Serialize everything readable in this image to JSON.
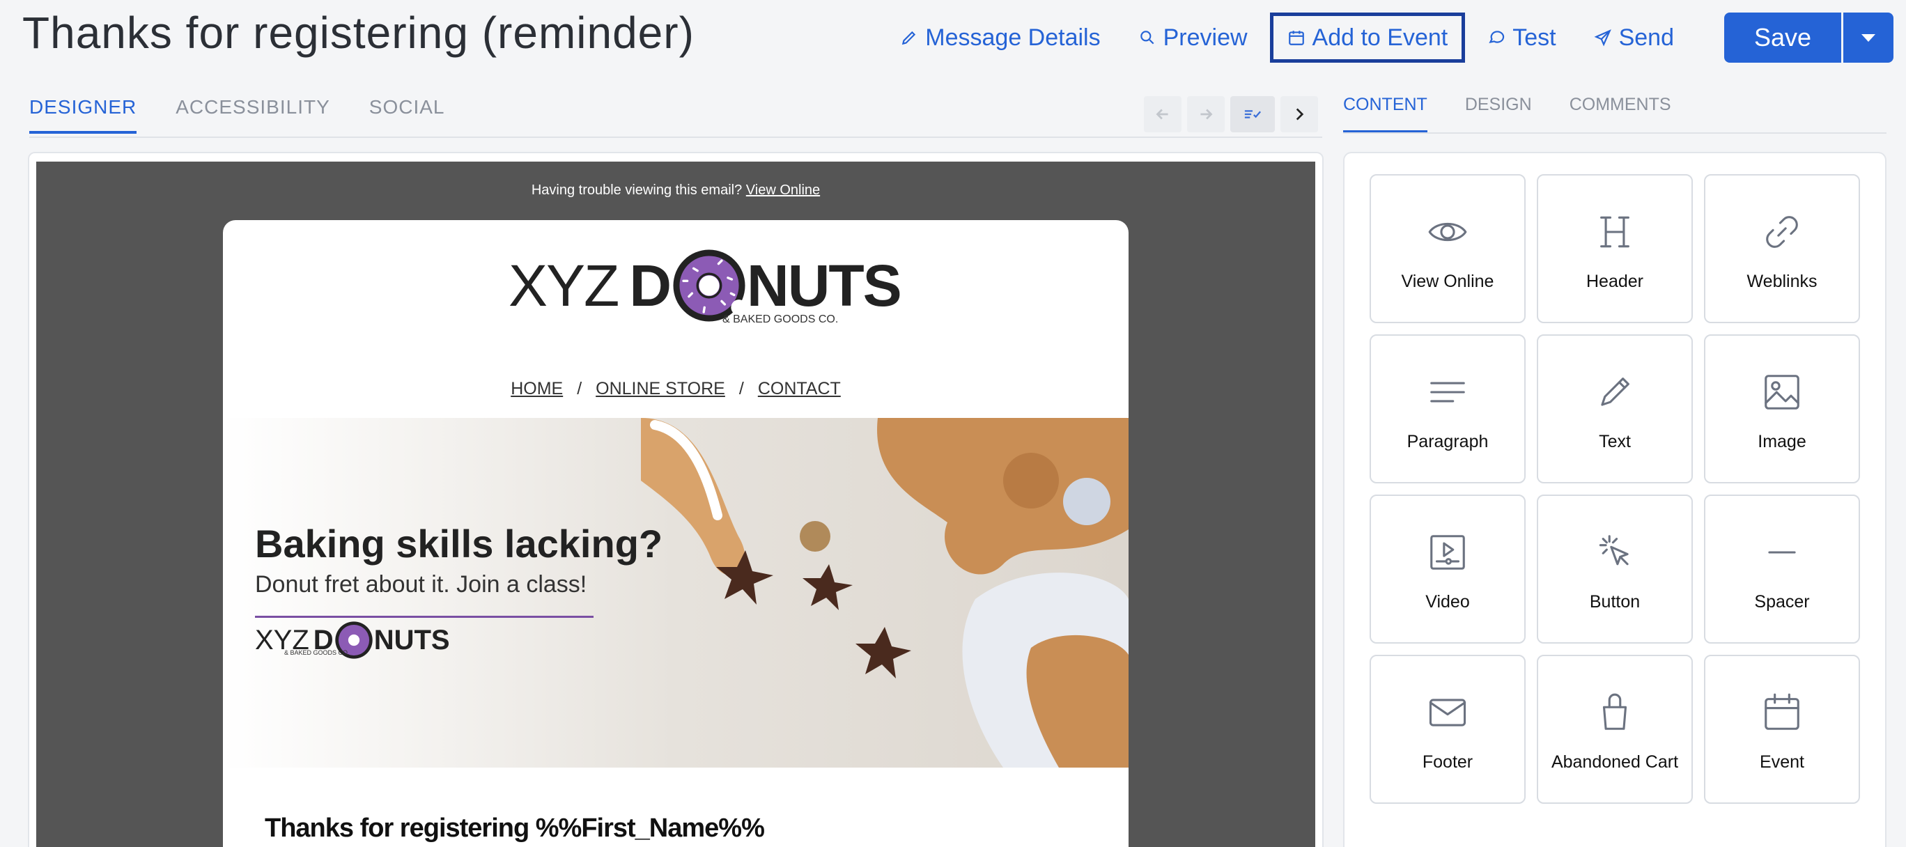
{
  "header": {
    "title": "Thanks for registering (reminder)",
    "actions": [
      {
        "label": "Message Details",
        "icon": "pencil-icon"
      },
      {
        "label": "Preview",
        "icon": "search-icon"
      },
      {
        "label": "Add to Event",
        "icon": "calendar-icon"
      },
      {
        "label": "Test",
        "icon": "comment-icon"
      },
      {
        "label": "Send",
        "icon": "send-icon"
      }
    ],
    "save_label": "Save"
  },
  "left_tabs": [
    "DESIGNER",
    "ACCESSIBILITY",
    "SOCIAL"
  ],
  "right_tabs": [
    "CONTENT",
    "DESIGN",
    "COMMENTS"
  ],
  "email": {
    "trouble_text": "Having trouble viewing this email?",
    "view_online": "View Online",
    "logo": {
      "xyz": "XYZ",
      "d": "D",
      "nuts": "NUTS",
      "sub": "& BAKED GOODS CO."
    },
    "nav": [
      "HOME",
      "ONLINE STORE",
      "CONTACT"
    ],
    "nav_sep": "/",
    "hero_title": "Baking skills lacking?",
    "hero_sub": "Donut fret about it. Join a class!",
    "thanks": "Thanks for registering %%First_Name%%"
  },
  "blocks": [
    {
      "label": "View Online",
      "icon": "eye-icon"
    },
    {
      "label": "Header",
      "icon": "heading-icon"
    },
    {
      "label": "Weblinks",
      "icon": "link-icon"
    },
    {
      "label": "Paragraph",
      "icon": "paragraph-icon"
    },
    {
      "label": "Text",
      "icon": "pencil-icon"
    },
    {
      "label": "Image",
      "icon": "image-icon"
    },
    {
      "label": "Video",
      "icon": "video-icon"
    },
    {
      "label": "Button",
      "icon": "cursor-click-icon"
    },
    {
      "label": "Spacer",
      "icon": "minus-icon"
    },
    {
      "label": "Footer",
      "icon": "envelope-icon"
    },
    {
      "label": "Abandoned Cart",
      "icon": "shopping-bag-icon"
    },
    {
      "label": "Event",
      "icon": "calendar-icon"
    }
  ],
  "colors": {
    "accent": "#2563d6",
    "focus_border": "#1a3e9b",
    "canvas_bg": "#555555",
    "donut": "#7a4fa3"
  }
}
